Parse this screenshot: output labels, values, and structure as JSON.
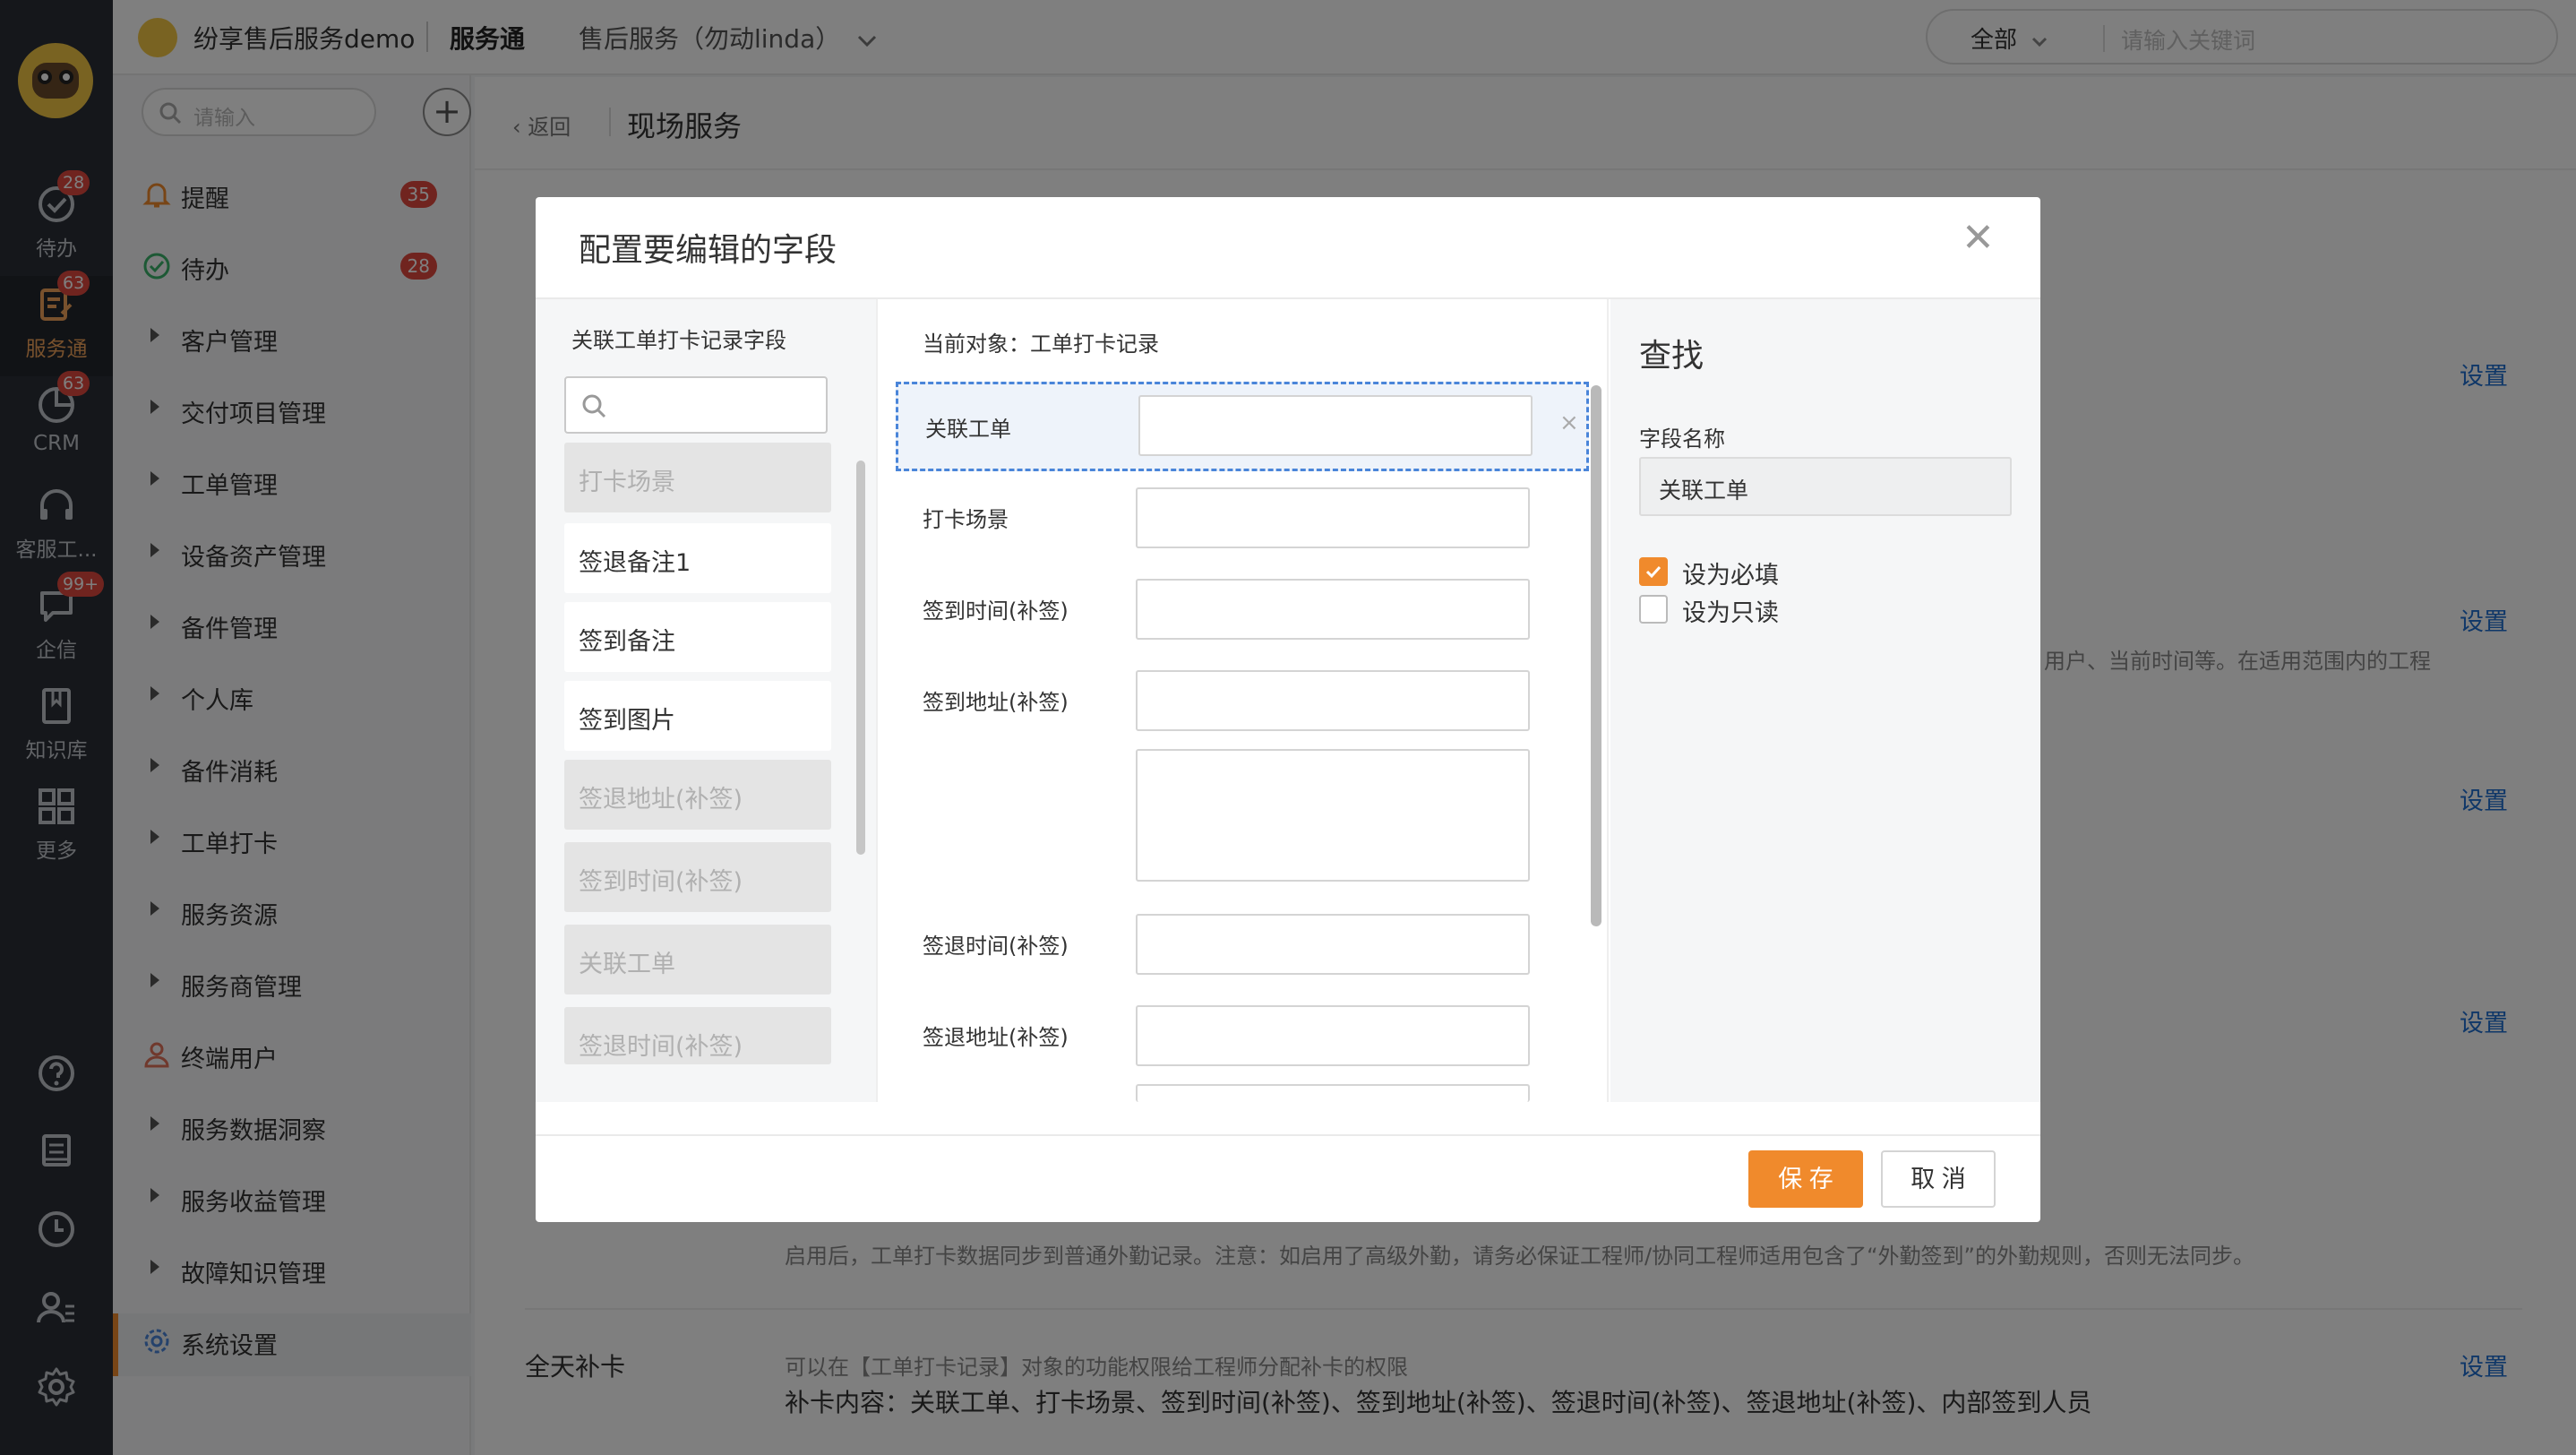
{
  "topbar": {
    "company": "纷享售后服务demo",
    "app": "服务通",
    "tenant": "售后服务（勿动linda）",
    "search_scope": "全部",
    "search_placeholder": "请输入关键词"
  },
  "rail": {
    "items": [
      {
        "label": "待办",
        "badge": "28",
        "icon": "check-circle-icon"
      },
      {
        "label": "服务通",
        "badge": "63",
        "icon": "service-icon"
      },
      {
        "label": "CRM",
        "badge": "63",
        "icon": "pie-chart-icon"
      },
      {
        "label": "客服工...",
        "badge": "",
        "icon": "headset-icon"
      },
      {
        "label": "企信",
        "badge": "99+",
        "icon": "chat-bubble-icon"
      },
      {
        "label": "知识库",
        "badge": "",
        "icon": "book-icon"
      },
      {
        "label": "更多",
        "badge": "",
        "icon": "grid-icon"
      }
    ]
  },
  "nav": {
    "search_placeholder": "请输入",
    "items": [
      {
        "label": "提醒",
        "badge": "35"
      },
      {
        "label": "待办",
        "badge": "28"
      },
      {
        "label": "客户管理"
      },
      {
        "label": "交付项目管理"
      },
      {
        "label": "工单管理"
      },
      {
        "label": "设备资产管理"
      },
      {
        "label": "备件管理"
      },
      {
        "label": "个人库"
      },
      {
        "label": "备件消耗"
      },
      {
        "label": "工单打卡"
      },
      {
        "label": "服务资源"
      },
      {
        "label": "服务商管理"
      },
      {
        "label": "终端用户"
      },
      {
        "label": "服务数据洞察"
      },
      {
        "label": "服务收益管理"
      },
      {
        "label": "故障知识管理"
      },
      {
        "label": "系统设置"
      }
    ],
    "collapse": "«"
  },
  "main": {
    "back": "返回",
    "title": "现场服务",
    "settings_link": "设置",
    "partial_text_1": "用户、当前时间等。在适用范围内的工程",
    "sync_note": "启用后，工单打卡数据同步到普通外勤记录。注意：如启用了高级外勤，请务必保证工程师/协同工程师适用包含了“外勤签到”的外勤规则，否则无法同步。",
    "row_allday_title": "全天补卡",
    "row_allday_desc": "可以在【工单打卡记录】对象的功能权限给工程师分配补卡的权限",
    "row_allday_content": "补卡内容：关联工单、打卡场景、签到时间(补签)、签到地址(补签)、签退时间(补签)、签退地址(补签)、内部签到人员"
  },
  "modal": {
    "title": "配置要编辑的字段",
    "left": {
      "header": "关联工单打卡记录字段",
      "fields": [
        {
          "label": "打卡场景",
          "used": true
        },
        {
          "label": "签退备注1",
          "used": false
        },
        {
          "label": "签到备注",
          "used": false
        },
        {
          "label": "签到图片",
          "used": false
        },
        {
          "label": "签退地址(补签)",
          "used": true
        },
        {
          "label": "签到时间(补签)",
          "used": true
        },
        {
          "label": "关联工单",
          "used": true
        },
        {
          "label": "签退时间(补签)",
          "used": true
        }
      ]
    },
    "middle": {
      "object_label": "当前对象：工单打卡记录",
      "fields": [
        "关联工单",
        "打卡场景",
        "签到时间(补签)",
        "签到地址(补签)",
        "签退时间(补签)",
        "签退地址(补签)"
      ],
      "remove": "×"
    },
    "right": {
      "title": "查找",
      "field_name_label": "字段名称",
      "field_name_value": "关联工单",
      "required_label": "设为必填",
      "required_checked": true,
      "readonly_label": "设为只读",
      "readonly_checked": false
    },
    "save": "保 存",
    "cancel": "取 消"
  },
  "colors": {
    "accent": "#f08a2c",
    "badge": "#e0493e",
    "link": "#1f6fd1",
    "rail": "#2b2f36"
  }
}
